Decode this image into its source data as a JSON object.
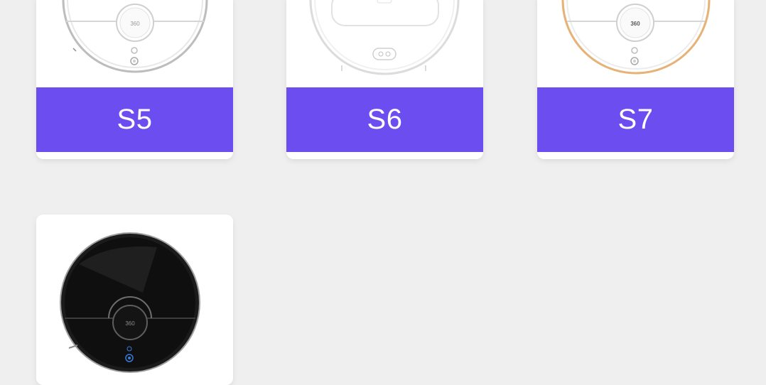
{
  "models": [
    {
      "name": "S5",
      "image": "robot-vacuum-white-image",
      "brand_mark": "360"
    },
    {
      "name": "S6",
      "image": "robot-vacuum-white-image",
      "brand_mark": ""
    },
    {
      "name": "S7",
      "image": "robot-vacuum-white-gold-image",
      "brand_mark": "360"
    },
    {
      "name": "",
      "image": "robot-vacuum-black-image",
      "brand_mark": "360"
    }
  ],
  "colors": {
    "background": "#efefef",
    "card": "#ffffff",
    "accent": "#6c4ef0",
    "label_text": "#ffffff"
  }
}
